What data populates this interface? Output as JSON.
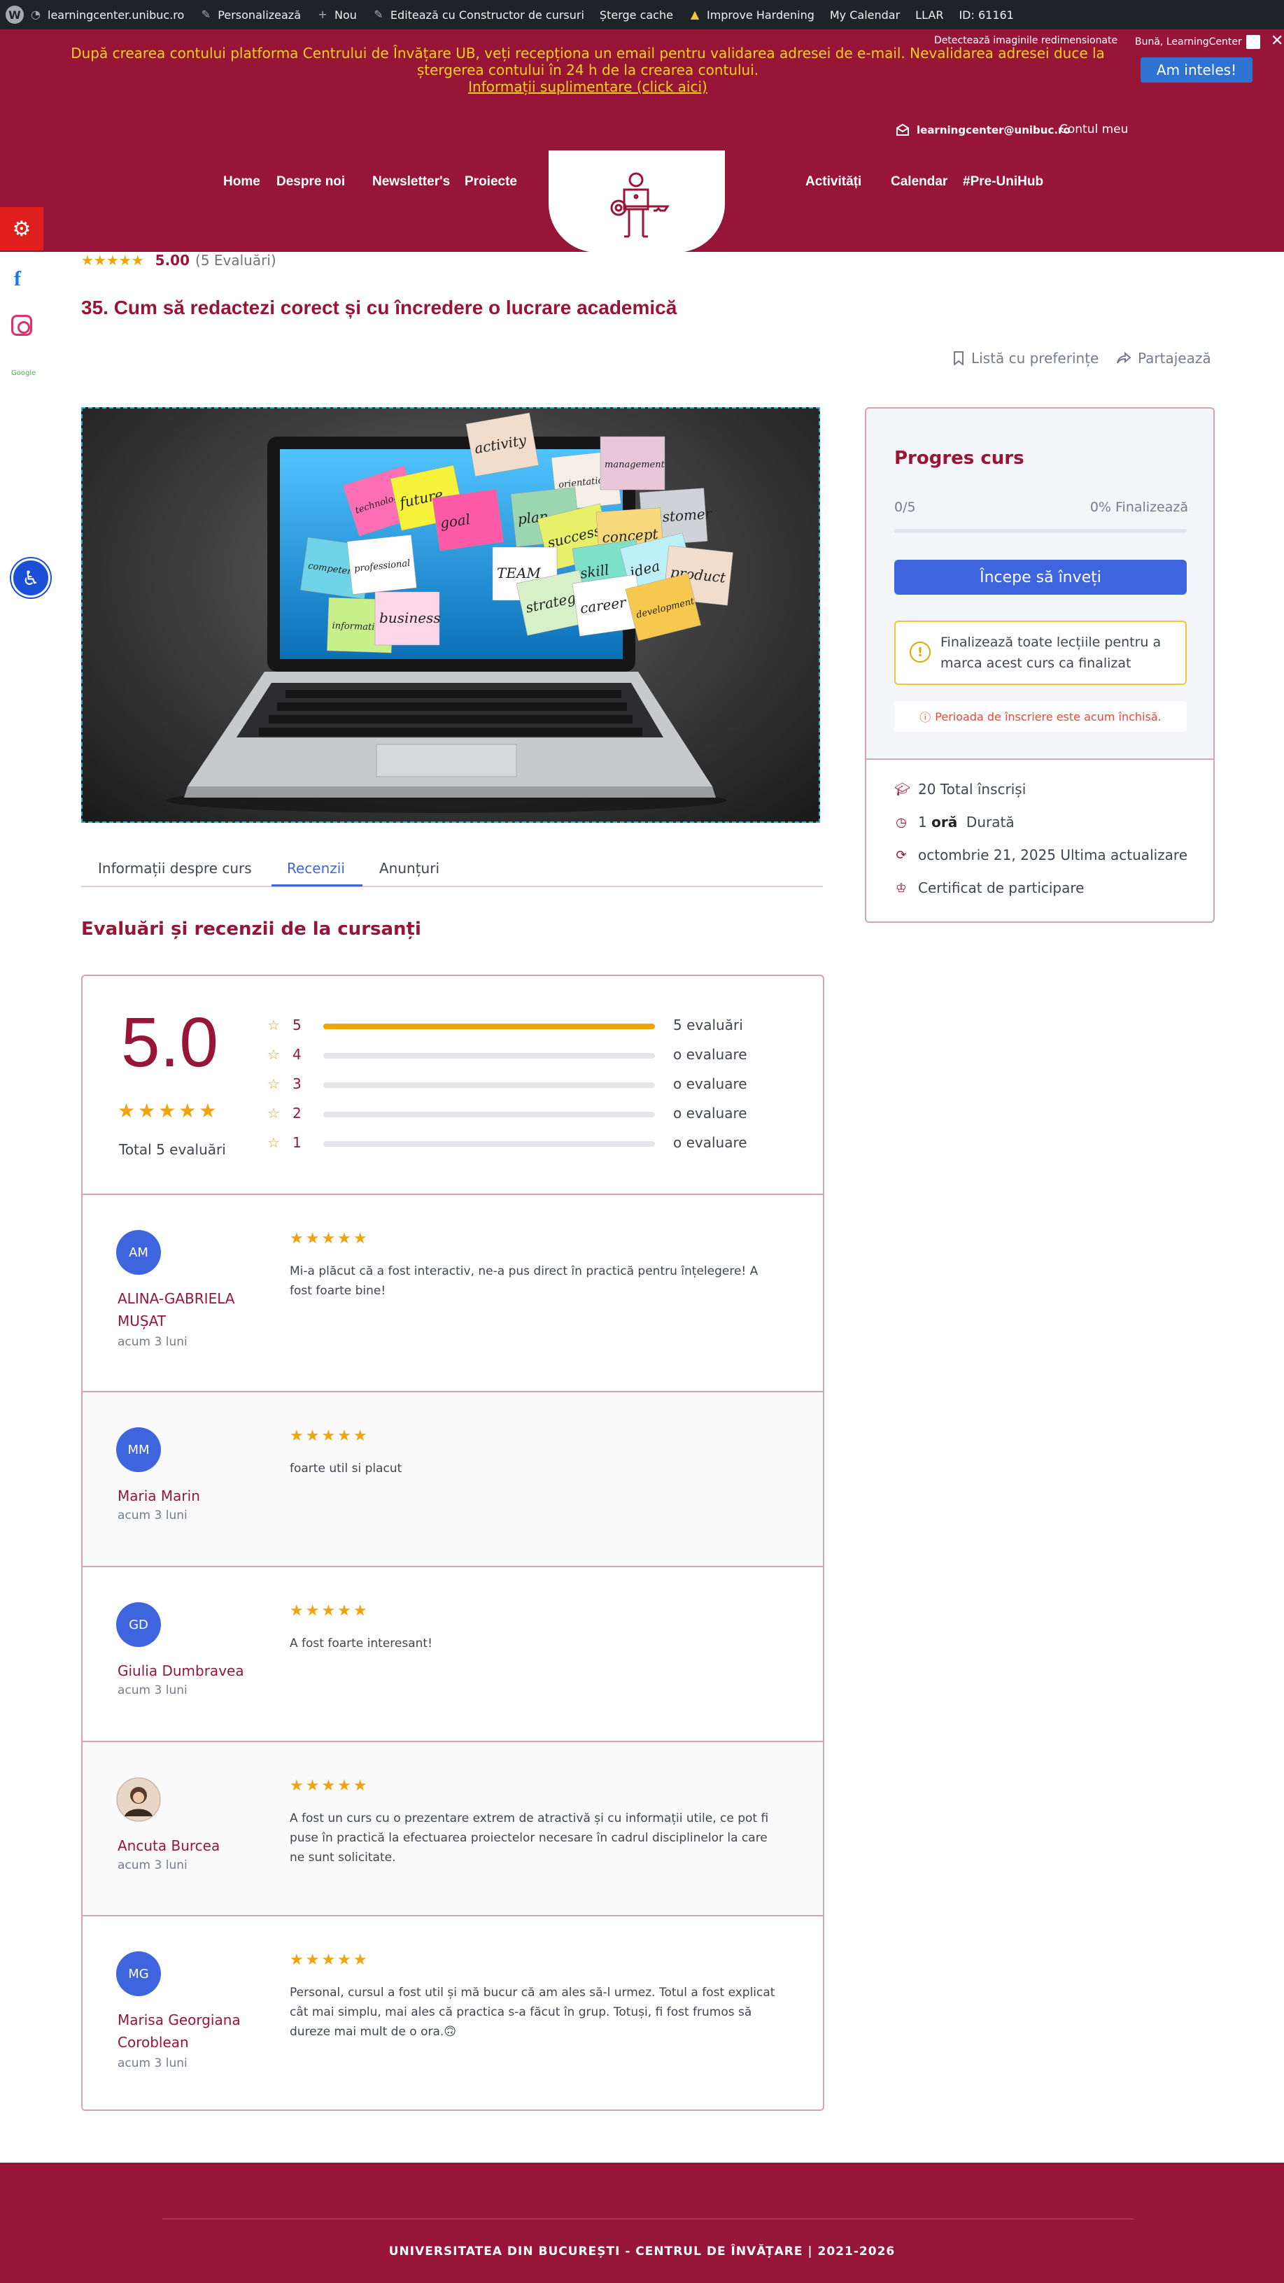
{
  "adminbar": {
    "site": "learningcenter.unibuc.ro",
    "customize": "Personalizează",
    "new": "Nou",
    "edit_builder": "Editează cu Constructor de cursuri",
    "clear_cache": "Șterge cache",
    "hardening": "Improve Hardening",
    "calendar": "My Calendar",
    "llar": "LLAR",
    "id": "ID: 61161"
  },
  "header": {
    "notice_line1": "După crearea contului platforma Centrului de Învățare UB, veți recepționa un email pentru validarea adresei de e-mail. Nevalidarea adresei duce la",
    "notice_line2": "ștergerea contului în 24 h de la crearea contului.",
    "notice_link": "Informații suplimentare (click aici)",
    "got_it": "Am inteles!",
    "resized_images": "Detectează imaginile redimensionate",
    "hello": "Bună, LearningCenter",
    "email": "learningcenter@unibuc.ro",
    "account": "Contul meu",
    "nav": [
      "Home",
      "Despre noi",
      "Newsletter's",
      "Proiecte",
      "Activități",
      "Calendar",
      "#Pre-UniHub"
    ],
    "accent": "#971637"
  },
  "side": {
    "google": "Google"
  },
  "course": {
    "rating_value": "5.00",
    "rating_count": "(5 Evaluări)",
    "title": "35. Cum să redactezi corect și cu încredere o lucrare academică",
    "wishlist": "Listă cu preferințe",
    "share": "Partajează",
    "cover_notes": [
      "technology",
      "future",
      "goal",
      "activity",
      "orientation",
      "management",
      "customer",
      "plan",
      "success",
      "concept",
      "competence",
      "professional",
      "TEAM",
      "skill",
      "idea",
      "product",
      "strategy",
      "career",
      "information",
      "business",
      "development"
    ]
  },
  "tabs": [
    "Informații despre curs",
    "Recenzii",
    "Anunțuri"
  ],
  "reviews": {
    "heading": "Evaluări și recenzii de la cursanți",
    "average": "5.0",
    "total": "Total 5 evaluări",
    "bars": [
      {
        "n": "5",
        "fraction": 1.0,
        "label": "5 evaluări"
      },
      {
        "n": "4",
        "fraction": 0,
        "label": "o evaluare"
      },
      {
        "n": "3",
        "fraction": 0,
        "label": "o evaluare"
      },
      {
        "n": "2",
        "fraction": 0,
        "label": "o evaluare"
      },
      {
        "n": "1",
        "fraction": 0,
        "label": "o evaluare"
      }
    ],
    "items": [
      {
        "initials": "AM",
        "name": "ALINA-GABRIELA MUȘAT",
        "date": "acum 3 luni",
        "stars": 5,
        "text": "Mi-a plăcut că a fost interactiv, ne-a pus direct în practică pentru înțelegere! A fost foarte bine!"
      },
      {
        "initials": "MM",
        "name": "Maria Marin",
        "date": "acum 3 luni",
        "stars": 5,
        "text": "foarte util si placut"
      },
      {
        "initials": "GD",
        "name": "Giulia Dumbravea",
        "date": "acum 3 luni",
        "stars": 5,
        "text": "A fost foarte interesant!"
      },
      {
        "initials": "",
        "name": "Ancuta Burcea",
        "date": "acum 3 luni",
        "stars": 5,
        "text": "A fost un curs cu o prezentare extrem de atractivă și cu informații utile, ce pot fi puse în practică la efectuarea proiectelor necesare în cadrul disciplinelor la care ne sunt solicitate."
      },
      {
        "initials": "MG",
        "name": "Marisa Georgiana Coroblean",
        "date": "acum 3 luni",
        "stars": 5,
        "text": "Personal, cursul a fost util și mă bucur că am ales să-l urmez. Totul a fost explicat cât mai simplu, mai ales că practica s-a făcut în grup. Totuși, fi fost frumos să dureze mai mult de o ora.🙃"
      }
    ]
  },
  "sidebar": {
    "progress_title": "Progres curs",
    "progress_count": "0/5",
    "progress_percent": "0% Finalizează",
    "progress_fraction": 0,
    "start_button": "Începe să înveți",
    "warning": "Finalizează toate lecțiile pentru a marca acest curs ca finalizat",
    "enrollment_closed": "Perioada de înscriere este acum închisă.",
    "enrolled": "20 Total înscriși",
    "duration_num": "1",
    "duration_unit": "oră",
    "duration_label": "Durată",
    "updated": "octombrie 21, 2025 Ultima actualizare",
    "certificate": "Certificat de participare"
  },
  "footer": {
    "text": "UNIVERSITATEA DIN BUCUREȘTI - CENTRUL DE ÎNVĂȚARE | 2021-2026"
  }
}
